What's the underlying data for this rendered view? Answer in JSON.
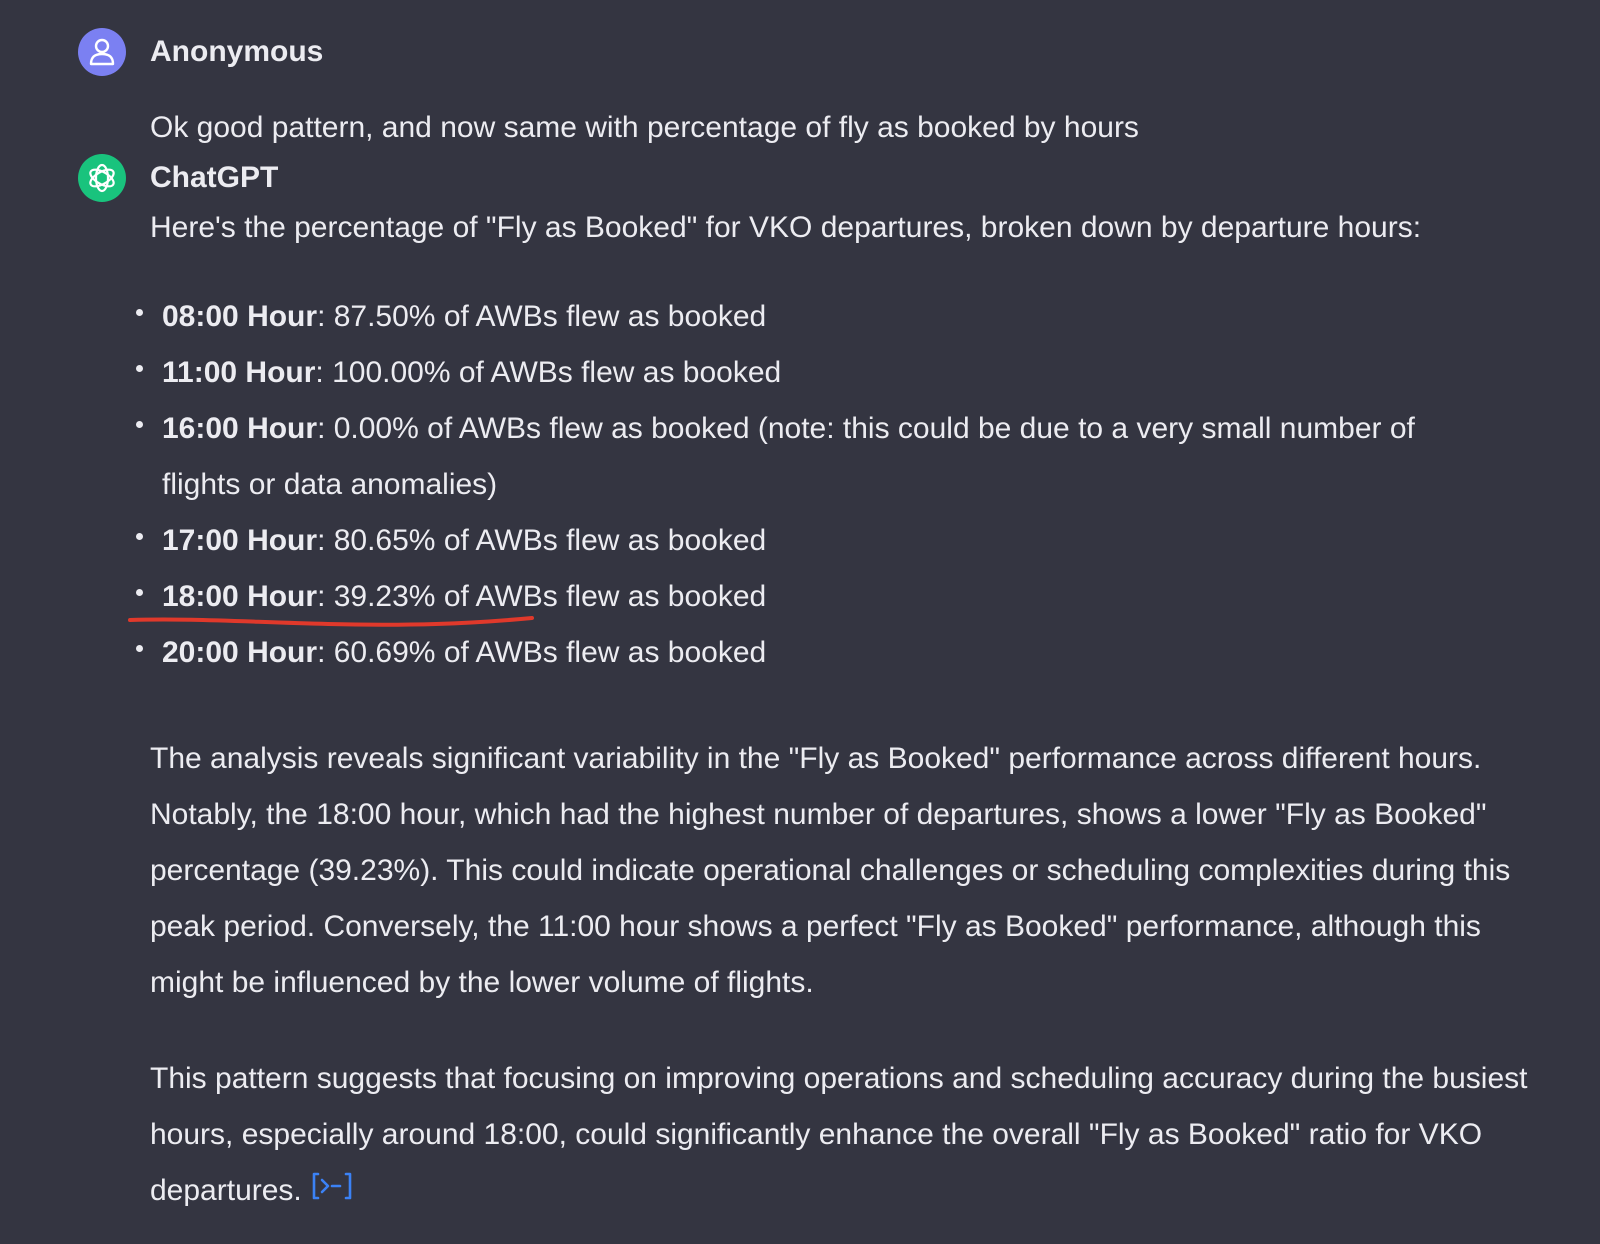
{
  "conversation": {
    "user_message": {
      "author": "Anonymous",
      "avatar_icon": "user-icon",
      "avatar_color": "#7b80f2",
      "text": "Ok good pattern, and now same with percentage of fly as booked by hours"
    },
    "assistant_message": {
      "author": "ChatGPT",
      "avatar_icon": "openai-logo-icon",
      "avatar_color": "#19c37d",
      "intro": "Here's the percentage of \"Fly as Booked\" for VKO departures, broken down by departure hours:",
      "bullets": [
        {
          "label": "08:00 Hour",
          "text": ": 87.50% of AWBs flew as booked"
        },
        {
          "label": "11:00 Hour",
          "text": ": 100.00% of AWBs flew as booked"
        },
        {
          "label": "16:00 Hour",
          "text": ": 0.00% of AWBs flew as booked (note: this could be due to a very small number of flights or data anomalies)"
        },
        {
          "label": "17:00 Hour",
          "text": ": 80.65% of AWBs flew as booked"
        },
        {
          "label": "18:00 Hour",
          "text": ": 39.23% of AWBs flew as booked"
        },
        {
          "label": "20:00 Hour",
          "text": ": 60.69% of AWBs flew as booked"
        }
      ],
      "paragraph_1": "The analysis reveals significant variability in the \"Fly as Booked\" performance across different hours. Notably, the 18:00 hour, which had the highest number of departures, shows a lower \"Fly as Booked\" percentage (39.23%). This could indicate operational challenges or scheduling complexities during this peak period. Conversely, the 11:00 hour shows a perfect \"Fly as Booked\" performance, although this might be influenced by the lower volume of flights.",
      "paragraph_2": "This pattern suggests that focusing on improving operations and scheduling accuracy during the busiest hours, especially around 18:00, could significantly enhance the overall \"Fly as Booked\" ratio for VKO departures.",
      "code_link_icon": "code-interpreter-icon"
    },
    "annotation": {
      "type": "hand-drawn underline",
      "color": "#e0392b"
    }
  }
}
